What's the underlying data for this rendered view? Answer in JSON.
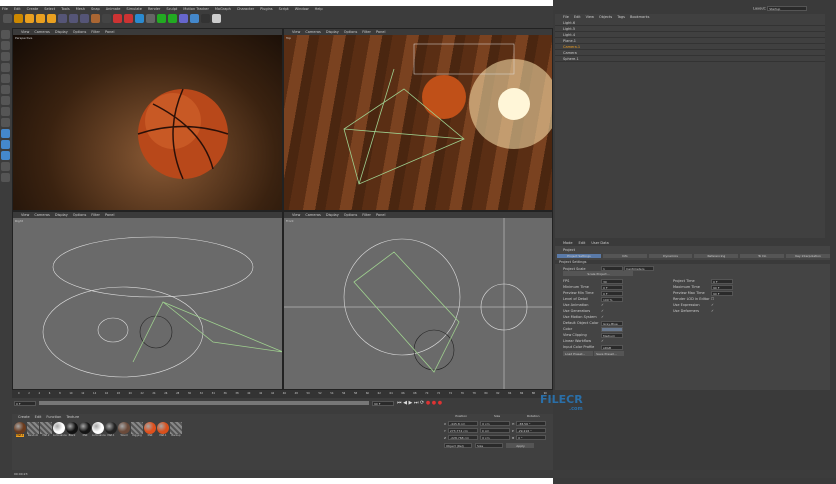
{
  "menu": [
    "File",
    "Edit",
    "Create",
    "Select",
    "Tools",
    "Mesh",
    "Snap",
    "Animate",
    "Simulate",
    "Render",
    "Sculpt",
    "Motion Tracker",
    "MoGraph",
    "Character",
    "Plugins",
    "Script",
    "Window",
    "Help"
  ],
  "layout": {
    "label": "Layout:",
    "value": "Startup"
  },
  "viewport_menu": [
    "View",
    "Cameras",
    "Display",
    "Options",
    "Filter",
    "Panel"
  ],
  "viewports": [
    {
      "name": "Perspective"
    },
    {
      "name": "Top"
    },
    {
      "name": "Right"
    },
    {
      "name": "Front"
    }
  ],
  "object_manager": {
    "menu": [
      "File",
      "Edit",
      "View",
      "Objects",
      "Tags",
      "Bookmarks"
    ],
    "objects": [
      "Light.6",
      "Light.5",
      "Light.4",
      "Plane.1",
      "Camera.1",
      "Camera",
      "Sphere.1"
    ],
    "selected": "Camera.1"
  },
  "attributes": {
    "menu": [
      "Mode",
      "Edit",
      "User Data"
    ],
    "title": "Project",
    "tabs": [
      "Project Settings",
      "Info",
      "Dynamics",
      "Referencing",
      "To Do",
      "Key Interpolation"
    ],
    "section": "Project Settings",
    "project_scale": {
      "label": "Project Scale",
      "value": "1",
      "unit": "Centimeters"
    },
    "scale_button": "Scale Project...",
    "left_fields": [
      {
        "label": "FPS",
        "value": "30"
      },
      {
        "label": "Minimum Time",
        "value": "0 F"
      },
      {
        "label": "Preview Min Time",
        "value": "0 F"
      },
      {
        "label": "Level of Detail",
        "value": "100 %"
      }
    ],
    "right_fields": [
      {
        "label": "Project Time",
        "value": "0 F"
      },
      {
        "label": "Maximum Time",
        "value": "90 F"
      },
      {
        "label": "Preview Max Time",
        "value": "90 F"
      },
      {
        "label": "Render LOD in Editor",
        "value": ""
      }
    ],
    "checks_left": [
      "Use Animation",
      "Use Generators",
      "Use Motion System"
    ],
    "checks_right": [
      "Use Expression",
      "Use Deformers"
    ],
    "default_color": {
      "label": "Default Object Color",
      "value": "Gray-Blue"
    },
    "color_label": "Color",
    "view_clipping": {
      "label": "View Clipping",
      "value": "Medium"
    },
    "linear_workflow": "Linear Workflow",
    "input_color_profile": {
      "label": "Input Color Profile",
      "value": "sRGB"
    },
    "load_preset": "Load Preset...",
    "save_preset": "Save Preset..."
  },
  "timeline": {
    "ticks": [
      "0",
      "2",
      "4",
      "6",
      "8",
      "10",
      "12",
      "14",
      "16",
      "18",
      "20",
      "22",
      "24",
      "26",
      "28",
      "30",
      "32",
      "34",
      "36",
      "38",
      "40",
      "42",
      "44",
      "46",
      "48",
      "50",
      "52",
      "54",
      "56",
      "58",
      "60",
      "62",
      "64",
      "66",
      "68",
      "70",
      "72",
      "74",
      "76",
      "78",
      "80",
      "82",
      "84",
      "86",
      "88",
      "90"
    ],
    "start": "0 F",
    "end": "90 F",
    "current": "0 F"
  },
  "materials": {
    "menu": [
      "Create",
      "Edit",
      "Function",
      "Texture"
    ],
    "items": [
      {
        "name": "Mat.1",
        "color": "#6b3a1c"
      },
      {
        "name": "Random",
        "color": "hatch"
      },
      {
        "name": "Mat.2",
        "color": "hatch"
      },
      {
        "name": "Luminance",
        "color": "#ffffff"
      },
      {
        "name": "Black",
        "color": "#111111"
      },
      {
        "name": "Mat",
        "color": "#151515"
      },
      {
        "name": "Luminance",
        "color": "#ffffff"
      },
      {
        "name": "Mat.1",
        "color": "#222222"
      },
      {
        "name": "Wood",
        "color": "#6a4a3a"
      },
      {
        "name": "Rigging",
        "color": "hatch"
      },
      {
        "name": "Mat",
        "color": "#e0501c"
      },
      {
        "name": "Mat.1",
        "color": "#d9501c"
      },
      {
        "name": "Backup",
        "color": "hatch"
      }
    ]
  },
  "coordinates": {
    "headers": [
      "Position",
      "Size",
      "Rotation"
    ],
    "rows": [
      {
        "axis": "X",
        "pos": "-445.8 cm",
        "size": "0 cm",
        "rot_axis": "H",
        "rot": "-38.56 °"
      },
      {
        "axis": "Y",
        "pos": "273.774 cm",
        "size": "0 cm",
        "rot_axis": "P",
        "rot": "-29.216 °"
      },
      {
        "axis": "Z",
        "pos": "-228.768 cm",
        "size": "0 cm",
        "rot_axis": "B",
        "rot": "0 °"
      }
    ],
    "mode": "Object (Rel)",
    "size_mode": "Size",
    "apply": "Apply"
  },
  "status": "00:00:23",
  "watermark": {
    "text": "FILECR",
    "sub": ".com"
  },
  "accent": "#f0a020"
}
